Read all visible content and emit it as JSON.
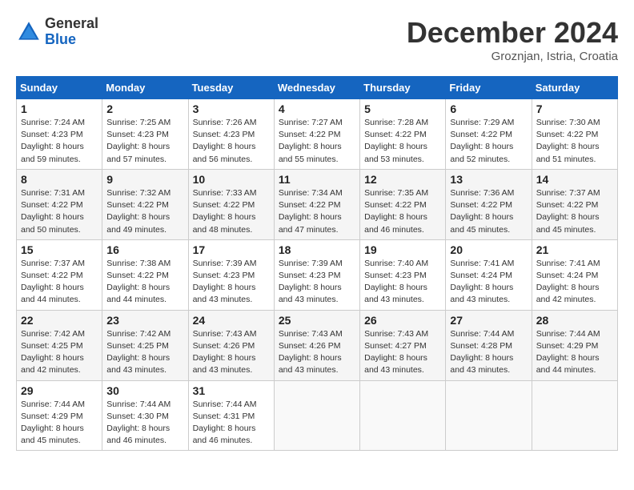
{
  "header": {
    "logo_general": "General",
    "logo_blue": "Blue",
    "month_title": "December 2024",
    "subtitle": "Groznjan, Istria, Croatia"
  },
  "columns": [
    "Sunday",
    "Monday",
    "Tuesday",
    "Wednesday",
    "Thursday",
    "Friday",
    "Saturday"
  ],
  "weeks": [
    [
      {
        "day": "1",
        "sunrise": "7:24 AM",
        "sunset": "4:23 PM",
        "daylight": "8 hours and 59 minutes."
      },
      {
        "day": "2",
        "sunrise": "7:25 AM",
        "sunset": "4:23 PM",
        "daylight": "8 hours and 57 minutes."
      },
      {
        "day": "3",
        "sunrise": "7:26 AM",
        "sunset": "4:23 PM",
        "daylight": "8 hours and 56 minutes."
      },
      {
        "day": "4",
        "sunrise": "7:27 AM",
        "sunset": "4:22 PM",
        "daylight": "8 hours and 55 minutes."
      },
      {
        "day": "5",
        "sunrise": "7:28 AM",
        "sunset": "4:22 PM",
        "daylight": "8 hours and 53 minutes."
      },
      {
        "day": "6",
        "sunrise": "7:29 AM",
        "sunset": "4:22 PM",
        "daylight": "8 hours and 52 minutes."
      },
      {
        "day": "7",
        "sunrise": "7:30 AM",
        "sunset": "4:22 PM",
        "daylight": "8 hours and 51 minutes."
      }
    ],
    [
      {
        "day": "8",
        "sunrise": "7:31 AM",
        "sunset": "4:22 PM",
        "daylight": "8 hours and 50 minutes."
      },
      {
        "day": "9",
        "sunrise": "7:32 AM",
        "sunset": "4:22 PM",
        "daylight": "8 hours and 49 minutes."
      },
      {
        "day": "10",
        "sunrise": "7:33 AM",
        "sunset": "4:22 PM",
        "daylight": "8 hours and 48 minutes."
      },
      {
        "day": "11",
        "sunrise": "7:34 AM",
        "sunset": "4:22 PM",
        "daylight": "8 hours and 47 minutes."
      },
      {
        "day": "12",
        "sunrise": "7:35 AM",
        "sunset": "4:22 PM",
        "daylight": "8 hours and 46 minutes."
      },
      {
        "day": "13",
        "sunrise": "7:36 AM",
        "sunset": "4:22 PM",
        "daylight": "8 hours and 45 minutes."
      },
      {
        "day": "14",
        "sunrise": "7:37 AM",
        "sunset": "4:22 PM",
        "daylight": "8 hours and 45 minutes."
      }
    ],
    [
      {
        "day": "15",
        "sunrise": "7:37 AM",
        "sunset": "4:22 PM",
        "daylight": "8 hours and 44 minutes."
      },
      {
        "day": "16",
        "sunrise": "7:38 AM",
        "sunset": "4:22 PM",
        "daylight": "8 hours and 44 minutes."
      },
      {
        "day": "17",
        "sunrise": "7:39 AM",
        "sunset": "4:23 PM",
        "daylight": "8 hours and 43 minutes."
      },
      {
        "day": "18",
        "sunrise": "7:39 AM",
        "sunset": "4:23 PM",
        "daylight": "8 hours and 43 minutes."
      },
      {
        "day": "19",
        "sunrise": "7:40 AM",
        "sunset": "4:23 PM",
        "daylight": "8 hours and 43 minutes."
      },
      {
        "day": "20",
        "sunrise": "7:41 AM",
        "sunset": "4:24 PM",
        "daylight": "8 hours and 43 minutes."
      },
      {
        "day": "21",
        "sunrise": "7:41 AM",
        "sunset": "4:24 PM",
        "daylight": "8 hours and 42 minutes."
      }
    ],
    [
      {
        "day": "22",
        "sunrise": "7:42 AM",
        "sunset": "4:25 PM",
        "daylight": "8 hours and 42 minutes."
      },
      {
        "day": "23",
        "sunrise": "7:42 AM",
        "sunset": "4:25 PM",
        "daylight": "8 hours and 43 minutes."
      },
      {
        "day": "24",
        "sunrise": "7:43 AM",
        "sunset": "4:26 PM",
        "daylight": "8 hours and 43 minutes."
      },
      {
        "day": "25",
        "sunrise": "7:43 AM",
        "sunset": "4:26 PM",
        "daylight": "8 hours and 43 minutes."
      },
      {
        "day": "26",
        "sunrise": "7:43 AM",
        "sunset": "4:27 PM",
        "daylight": "8 hours and 43 minutes."
      },
      {
        "day": "27",
        "sunrise": "7:44 AM",
        "sunset": "4:28 PM",
        "daylight": "8 hours and 43 minutes."
      },
      {
        "day": "28",
        "sunrise": "7:44 AM",
        "sunset": "4:29 PM",
        "daylight": "8 hours and 44 minutes."
      }
    ],
    [
      {
        "day": "29",
        "sunrise": "7:44 AM",
        "sunset": "4:29 PM",
        "daylight": "8 hours and 45 minutes."
      },
      {
        "day": "30",
        "sunrise": "7:44 AM",
        "sunset": "4:30 PM",
        "daylight": "8 hours and 46 minutes."
      },
      {
        "day": "31",
        "sunrise": "7:44 AM",
        "sunset": "4:31 PM",
        "daylight": "8 hours and 46 minutes."
      },
      null,
      null,
      null,
      null
    ]
  ]
}
